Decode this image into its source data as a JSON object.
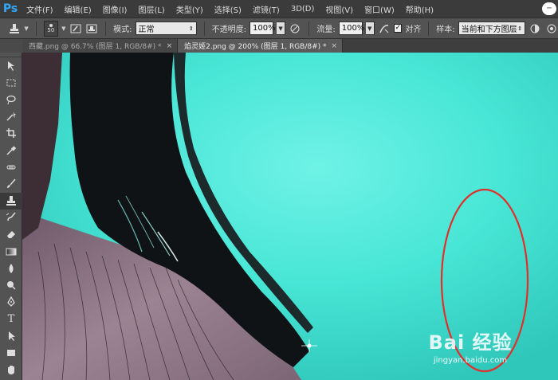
{
  "app": {
    "logo": "Ps"
  },
  "menu": [
    "文件(F)",
    "编辑(E)",
    "图像(I)",
    "图层(L)",
    "类型(Y)",
    "选择(S)",
    "滤镜(T)",
    "3D(D)",
    "视图(V)",
    "窗口(W)",
    "帮助(H)"
  ],
  "options": {
    "brush_size": "50",
    "mode_label": "模式:",
    "mode_value": "正常",
    "opacity_label": "不透明度:",
    "opacity_value": "100%",
    "flow_label": "流量:",
    "flow_value": "100%",
    "aligned_label": "对齐",
    "aligned_checked": true,
    "sample_label": "样本:",
    "sample_value": "当前和下方图层"
  },
  "tabs": [
    {
      "label": "西藏.png @ 66.7% (图层 1, RGB/8#) *",
      "close": "×",
      "active": false
    },
    {
      "label": "焰灵姬2.png @ 200% (图层 1, RGB/8#) *",
      "close": "×",
      "active": true
    }
  ],
  "tools": [
    "move-icon",
    "marquee-icon",
    "lasso-icon",
    "magic-wand-icon",
    "crop-icon",
    "eyedropper-icon",
    "healing-brush-icon",
    "brush-icon",
    "clone-stamp-icon",
    "history-brush-icon",
    "eraser-icon",
    "gradient-icon",
    "blur-icon",
    "dodge-icon",
    "pen-icon",
    "type-icon",
    "path-selection-icon",
    "rectangle-icon",
    "hand-icon"
  ],
  "active_tool": "clone-stamp-icon",
  "watermark": {
    "logo": "Bai 经验",
    "url": "jingyan.baidu.com"
  },
  "colors": {
    "annotation_circle": "#e0302a",
    "canvas_cyan": "#3ee8d8",
    "hair": "#101316",
    "skin": "#8a7080"
  }
}
